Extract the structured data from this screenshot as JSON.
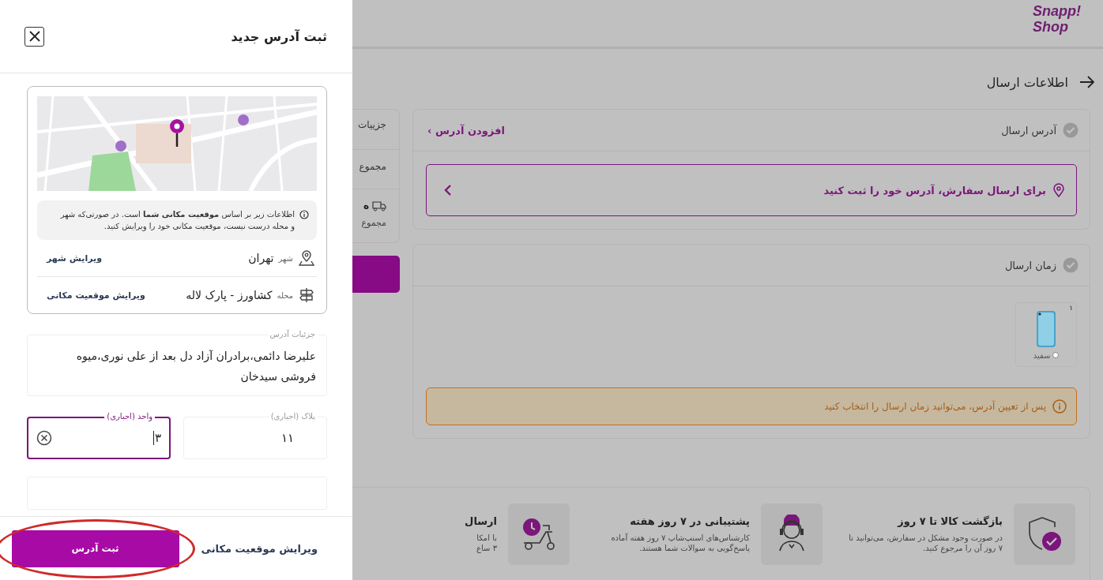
{
  "drawer": {
    "title": "ثبت آدرس جدید",
    "info": "اطلاعات زیر بر اساس **موقعیت مکانی شما** است. در صورتی‌که شهر و محله درست نیست، موقعیت مکانی خود را ویرایش کنید.",
    "location_rows": [
      {
        "kind": "city",
        "label": "شهر",
        "value": "تهران",
        "action": "ویرایش شهر"
      },
      {
        "kind": "neighborhood",
        "label": "محله",
        "value": "کشاورز - پارک لاله",
        "action": "ویرایش موقعیت مکانی"
      }
    ],
    "address_details": {
      "label": "جزئیات آدرس",
      "value": "علیرضا دائمی،برادران آزاد دل بعد از علی نوری،میوه فروشی سیدخان"
    },
    "fields": [
      {
        "label": "پلاک (اجباری)",
        "value": "۱۱",
        "focused": false
      },
      {
        "label": "واحد (اجباری)",
        "value": "۳",
        "focused": true
      }
    ],
    "footer": {
      "submit": "ثبت آدرس",
      "submit_highlighted": true,
      "edit_location": "ویرایش موقعیت مکانی"
    }
  },
  "header": {
    "logo": [
      "Snapp!",
      "Shop"
    ]
  },
  "page_title": "اطلاعات ارسال",
  "address_section": {
    "title": "آدرس ارسال",
    "link": "افزودن آدرس ›",
    "prompt": "برای ارسال سفارش، آدرس خود را ثبت کنید"
  },
  "time_section": {
    "title": "زمان ارسال",
    "products": [
      {
        "count": "۱",
        "color_name": "سفید"
      }
    ],
    "notice": "پس از تعیین آدرس، می‌توانید زمان ارسال را انتخاب کنید"
  },
  "summary": [
    {
      "kind": "heading",
      "text": "جزییات"
    },
    {
      "kind": "row",
      "text": "مجموع"
    },
    {
      "kind": "shipping",
      "text": "ه"
    },
    {
      "kind": "note",
      "text": "مجموع"
    }
  ],
  "features": [
    {
      "kind": "return",
      "title": "بازگشت کالا تا ۷ روز",
      "lines": [
        "در صورت وجود مشکل در سفارش، می‌توانید تا",
        "۷ روز آن را مرجوع کنید."
      ]
    },
    {
      "kind": "support",
      "title": "پشتیبانی در ۷ روز هفته",
      "lines": [
        "کارشناس‌های اسنپ‌شاپ ۷ روز هفته آماده",
        "پاسخ‌گویی به سوالات شما هستند."
      ]
    },
    {
      "kind": "delivery",
      "title": "ارسال",
      "lines": [
        "با امکا",
        "۳ ساع"
      ]
    }
  ]
}
